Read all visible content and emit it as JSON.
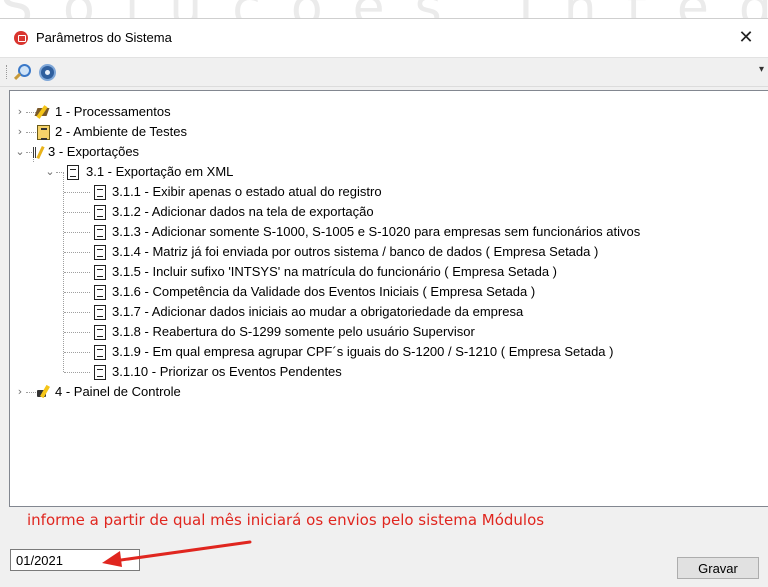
{
  "watermark": "Soluções Integradas",
  "window": {
    "title": "Parâmetros do Sistema",
    "close_glyph": "✕"
  },
  "toolbar": {
    "icons": [
      "search-icon",
      "config-icon"
    ],
    "overflow_glyph": "▾"
  },
  "tree": {
    "nodes": [
      {
        "label": "1 - Processamentos",
        "state": "collapsed",
        "icon": "processing-icon"
      },
      {
        "label": "2 - Ambiente de Testes",
        "state": "collapsed",
        "icon": "test-environment-icon"
      },
      {
        "label": "3 - Exportações",
        "state": "expanded",
        "icon": "exports-icon"
      },
      {
        "label": "3.1 - Exportação em XML",
        "state": "expanded",
        "icon": "document-icon"
      },
      {
        "label": "3.1.1 - Exibir apenas o estado atual do registro",
        "icon": "document-icon"
      },
      {
        "label": "3.1.2 - Adicionar dados na tela de exportação",
        "icon": "document-icon"
      },
      {
        "label": "3.1.3 - Adicionar somente S-1000, S-1005 e S-1020 para empresas sem funcionários ativos",
        "icon": "document-icon"
      },
      {
        "label": "3.1.4 - Matriz já foi enviada por outros sistema / banco de dados ( Empresa Setada )",
        "icon": "document-icon"
      },
      {
        "label": "3.1.5 - Incluir sufixo 'INTSYS' na matrícula do funcionário ( Empresa Setada )",
        "icon": "document-icon"
      },
      {
        "label": "3.1.6 - Competência da Validade dos Eventos Iniciais ( Empresa Setada )",
        "icon": "document-icon"
      },
      {
        "label": "3.1.7 - Adicionar dados iniciais ao mudar a obrigatoriedade da empresa",
        "icon": "document-icon"
      },
      {
        "label": "3.1.8 - Reabertura do S-1299 somente pelo usuário Supervisor",
        "icon": "document-icon"
      },
      {
        "label": "3.1.9 - Em qual empresa agrupar CPF´s iguais do S-1200 / S-1210 ( Empresa Setada )",
        "icon": "document-icon"
      },
      {
        "label": "3.1.10 - Priorizar os Eventos Pendentes",
        "icon": "document-icon"
      },
      {
        "label": "4 - Painel de Controle",
        "state": "collapsed",
        "icon": "control-panel-icon"
      }
    ]
  },
  "hint_text": "informe a partir de qual mês iniciará os envios pelo sistema Módulos",
  "month_input": {
    "value": "01/2021"
  },
  "save_button": {
    "label": "Gravar"
  },
  "colors": {
    "annotation": "#e0261f",
    "panel_bg": "#f0f0f0"
  }
}
